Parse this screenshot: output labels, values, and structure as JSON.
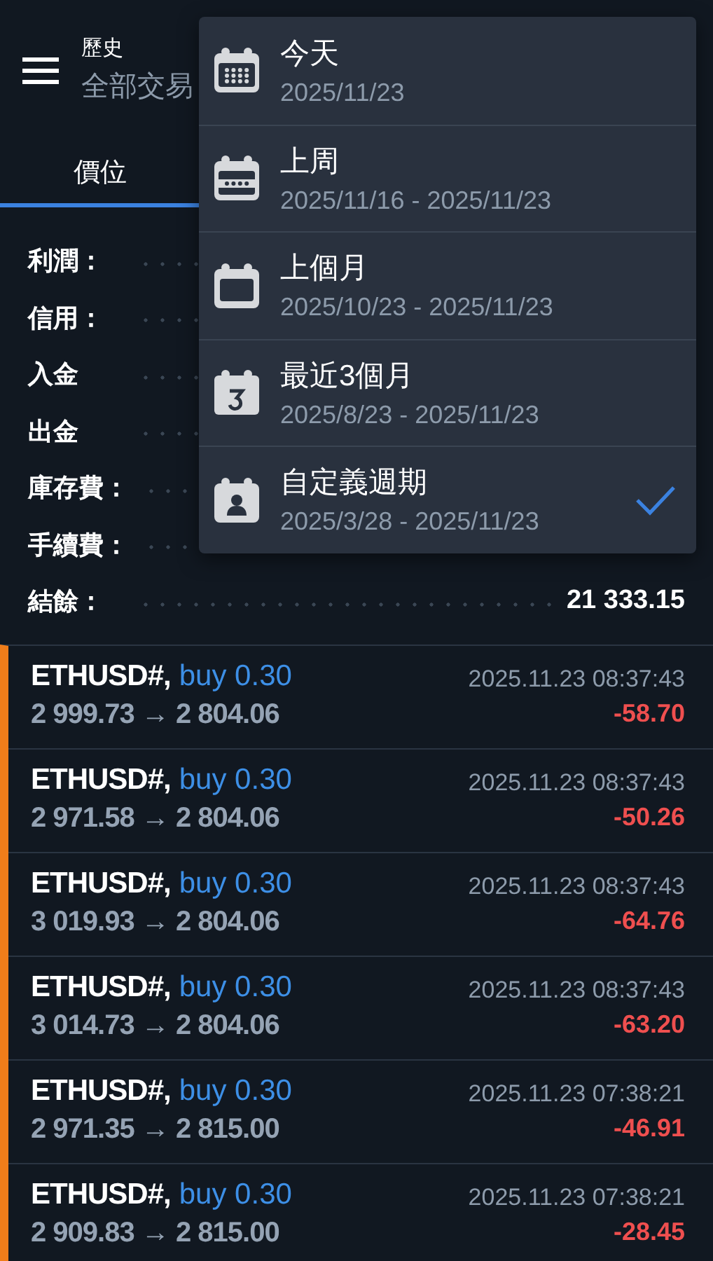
{
  "header": {
    "title": "歷史",
    "subtitle": "全部交易"
  },
  "tabs": [
    {
      "label": "價位",
      "selected": true
    }
  ],
  "summary": [
    {
      "label": "利潤："
    },
    {
      "label": "信用："
    },
    {
      "label": "入金"
    },
    {
      "label": "出金"
    },
    {
      "label": "庫存費："
    },
    {
      "label": "手續費："
    },
    {
      "label": "結餘：",
      "value": "21 333.15"
    }
  ],
  "trades": [
    {
      "symbol": "ETHUSD#,",
      "side": "buy 0.30",
      "prices": "2 999.73 → 2 804.06",
      "time": "2025.11.23 08:37:43",
      "profit": "-58.70"
    },
    {
      "symbol": "ETHUSD#,",
      "side": "buy 0.30",
      "prices": "2 971.58 → 2 804.06",
      "time": "2025.11.23 08:37:43",
      "profit": "-50.26"
    },
    {
      "symbol": "ETHUSD#,",
      "side": "buy 0.30",
      "prices": "3 019.93 → 2 804.06",
      "time": "2025.11.23 08:37:43",
      "profit": "-64.76"
    },
    {
      "symbol": "ETHUSD#,",
      "side": "buy 0.30",
      "prices": "3 014.73 → 2 804.06",
      "time": "2025.11.23 08:37:43",
      "profit": "-63.20"
    },
    {
      "symbol": "ETHUSD#,",
      "side": "buy 0.30",
      "prices": "2 971.35 → 2 815.00",
      "time": "2025.11.23 07:38:21",
      "profit": "-46.91"
    },
    {
      "symbol": "ETHUSD#,",
      "side": "buy 0.30",
      "prices": "2 909.83 → 2 815.00",
      "time": "2025.11.23 07:38:21",
      "profit": "-28.45"
    }
  ],
  "period_menu": [
    {
      "kind": "day",
      "label": "今天",
      "range": "2025/11/23",
      "selected": false
    },
    {
      "kind": "week",
      "label": "上周",
      "range": "2025/11/16 - 2025/11/23",
      "selected": false
    },
    {
      "kind": "month",
      "label": "上個月",
      "range": "2025/10/23 - 2025/11/23",
      "selected": false
    },
    {
      "kind": "three",
      "label": "最近3個月",
      "range": "2025/8/23 - 2025/11/23",
      "selected": false
    },
    {
      "kind": "custom",
      "label": "自定義週期",
      "range": "2025/3/28 - 2025/11/23",
      "selected": true
    }
  ]
}
